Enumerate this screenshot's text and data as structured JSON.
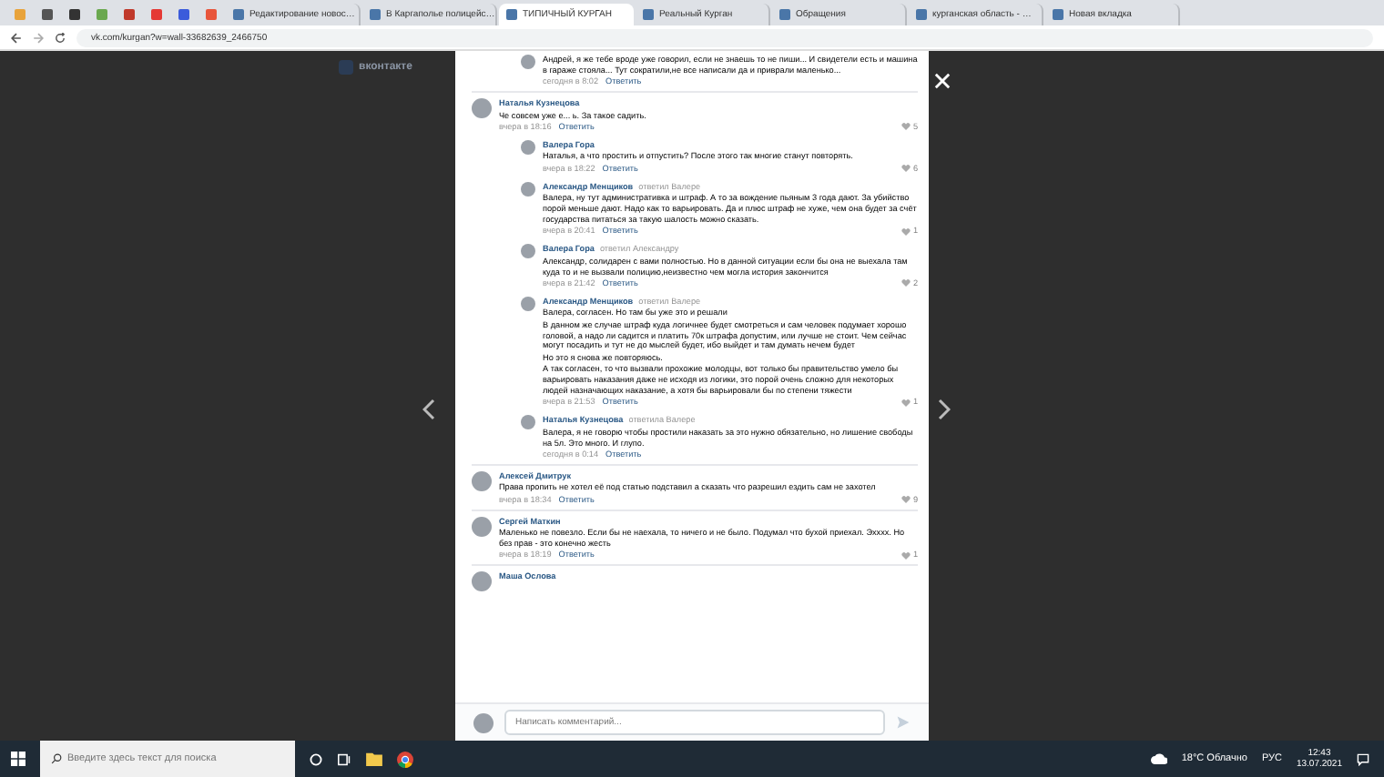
{
  "browser": {
    "tabs": [
      {
        "label": "Редактирование новос…",
        "selected": false
      },
      {
        "label": "В Каргаполье полицейс…",
        "selected": false
      },
      {
        "label": "ТИПИЧНЫЙ КУРГАН",
        "selected": true
      },
      {
        "label": "Реальный Курган",
        "selected": false
      },
      {
        "label": "Обращения",
        "selected": false
      },
      {
        "label": "курганская область - …",
        "selected": false
      },
      {
        "label": "Новая вкладка",
        "selected": false
      }
    ],
    "url": "vk.com/kurgan?w=wall-33682639_2466750"
  },
  "site": {
    "logo": "вконтакте"
  },
  "comments": [
    {
      "replies": [
        {
          "text": "Андрей, я же тебе вроде уже говорил, если не знаешь то не пиши... И свидетели есть и машина в гараже стояла... Тут сократили,не все написали да и приврали маленько...",
          "time": "сегодня в 8:02",
          "reply_link": "Ответить"
        }
      ]
    },
    {
      "author": "Наталья Кузнецова",
      "text": "Че совсем уже е... ь. За такое садить.",
      "time": "вчера в 18:16",
      "reply_link": "Ответить",
      "likes": "5",
      "replies": [
        {
          "author": "Валера Гора",
          "text": "Наталья, а что простить и отпустить? После этого так многие станут повторять.",
          "time": "вчера в 18:22",
          "reply_link": "Ответить",
          "likes": "6"
        },
        {
          "author": "Александр Менщиков",
          "reply_to": "ответил Валере",
          "text": "Валера, ну тут административка и штраф. А то за вождение пьяным 3 года дают. За убийство порой меньше дают. Надо как то варьировать. Да и плюс штраф не хуже, чем она будет за счёт государства питаться за такую шалость можно сказать.",
          "time": "вчера в 20:41",
          "reply_link": "Ответить",
          "likes": "1"
        },
        {
          "author": "Валера Гора",
          "reply_to": "ответил Александру",
          "text": "Александр, солидарен с вами полностью. Но в данной ситуации если бы она не выехала там куда то и не вызвали полицию,неизвестно чем могла история закончится",
          "time": "вчера в 21:42",
          "reply_link": "Ответить",
          "likes": "2"
        },
        {
          "author": "Александр Менщиков",
          "reply_to": "ответил Валере",
          "paragraphs": [
            "Валера, согласен. Но там бы уже это и решали",
            "В данном же случае штраф куда логичнее будет смотреться и сам человек подумает хорошо головой, а надо ли садится и платить 70к штрафа допустим, или лучше не стоит. Чем сейчас могут посадить и тут не до мыслей будет, ибо выйдет и там думать нечем будет",
            "Но это я снова же повторяюсь.",
            "А так согласен, то что вызвали прохожие молодцы, вот только бы правительство умело бы варьировать наказания даже не исходя из логики, это порой очень сложно для некоторых людей назначающих наказание, а хотя бы варьировали бы по степени тяжести"
          ],
          "time": "вчера в 21:53",
          "reply_link": "Ответить",
          "likes": "1"
        },
        {
          "author": "Наталья Кузнецова",
          "reply_to": "ответила Валере",
          "text": "Валера, я не говорю чтобы простили наказать за это нужно обязательно, но лишение свободы на 5л. Это много. И глупо.",
          "time": "сегодня в 0:14",
          "reply_link": "Ответить"
        }
      ]
    },
    {
      "author": "Алексей Дмитрук",
      "text": "Права пропить не хотел её под статью подставил а сказать что разрешил ездить сам не захотел",
      "time": "вчера в 18:34",
      "reply_link": "Ответить",
      "likes": "9"
    },
    {
      "author": "Сергей Маткин",
      "text": "Маленько не повезло. Если бы не наехала, то ничего и не было. Подумал что бухой приехал. Эхххх. Но без прав - это конечно жесть",
      "time": "вчера в 18:19",
      "reply_link": "Ответить",
      "likes": "1"
    },
    {
      "author": "Маша Ослова"
    }
  ],
  "comment_input": {
    "placeholder": "Написать комментарий..."
  },
  "taskbar": {
    "search_placeholder": "Введите здесь текст для поиска",
    "weather": "18°C Облачно",
    "language": "РУС",
    "time": "12:43",
    "date": "13.07.2021"
  }
}
